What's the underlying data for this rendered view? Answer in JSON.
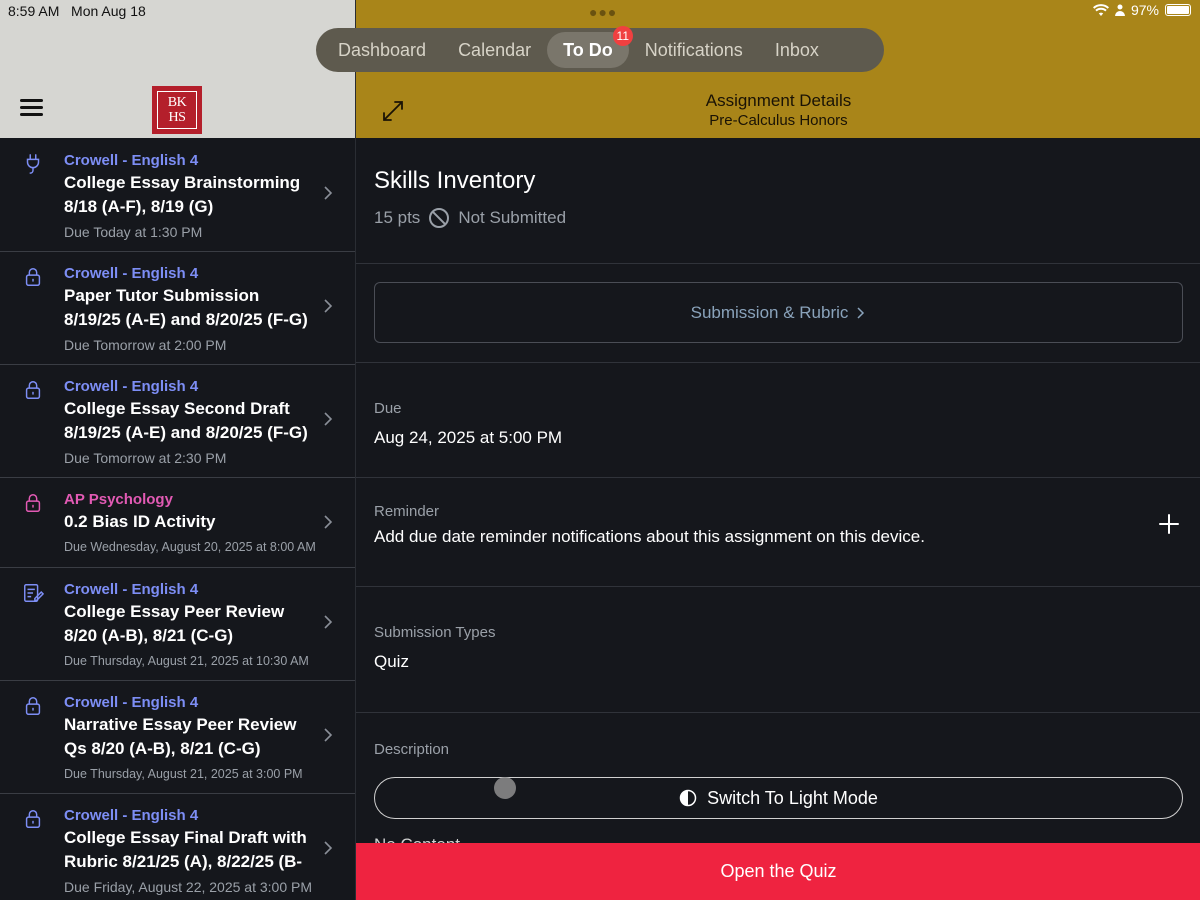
{
  "status": {
    "time": "8:59 AM",
    "date": "Mon Aug 18",
    "battery": "97%"
  },
  "tabs": [
    {
      "label": "Dashboard"
    },
    {
      "label": "Calendar"
    },
    {
      "label": "To Do",
      "badge": "11"
    },
    {
      "label": "Notifications"
    },
    {
      "label": "Inbox"
    }
  ],
  "logo": {
    "line1": "BK",
    "line2": "HS"
  },
  "todos": [
    {
      "course": "Crowell - English 4",
      "title": "College Essay Brainstorming 8/18 (A-F), 8/19 (G)",
      "due": "Due Today at 1:30 PM",
      "icon": "plug-icon"
    },
    {
      "course": "Crowell - English 4",
      "title": "Paper Tutor Submission 8/19/25 (A-E) and 8/20/25 (F-G)",
      "due": "Due Tomorrow at 2:00 PM",
      "icon": "lock-icon"
    },
    {
      "course": "Crowell - English 4",
      "title": "College Essay Second Draft 8/19/25 (A-E) and 8/20/25 (F-G)",
      "due": "Due Tomorrow at 2:30 PM",
      "icon": "lock-icon"
    },
    {
      "course": "AP Psychology",
      "title": "0.2 Bias ID Activity",
      "due": "Due Wednesday, August 20, 2025 at 8:00 AM",
      "icon": "lock-icon"
    },
    {
      "course": "Crowell - English 4",
      "title": "College Essay Peer Review 8/20 (A-B), 8/21 (C-G)",
      "due": "Due Thursday, August 21, 2025 at 10:30 AM",
      "icon": "edit-document-icon"
    },
    {
      "course": "Crowell - English 4",
      "title": "Narrative Essay Peer Review Qs 8/20 (A-B), 8/21 (C-G)",
      "due": "Due Thursday, August 21, 2025 at 3:00 PM",
      "icon": "lock-icon"
    },
    {
      "course": "Crowell - English 4",
      "title": "College Essay Final Draft with Rubric 8/21/25 (A), 8/22/25 (B-",
      "due": "Due Friday, August 22, 2025 at 3:00 PM",
      "icon": "lock-icon"
    }
  ],
  "header": {
    "title": "Assignment Details",
    "subtitle": "Pre-Calculus Honors"
  },
  "assignment": {
    "title": "Skills Inventory",
    "points": "15 pts",
    "status": "Not Submitted",
    "submission_button": "Submission & Rubric",
    "due_label": "Due",
    "due_value": "Aug 24, 2025 at 5:00 PM",
    "reminder_label": "Reminder",
    "reminder_value": "Add due date reminder notifications about this assignment on this device.",
    "types_label": "Submission Types",
    "types_value": "Quiz",
    "description_label": "Description",
    "description_value": "No Content",
    "light_mode_button": "Switch To Light Mode",
    "open_button": "Open the Quiz"
  },
  "colors": {
    "accent_header": "#a98519",
    "course_blue": "#7d8ef5",
    "course_pink": "#e25ab4",
    "primary_button": "#ef2340"
  }
}
